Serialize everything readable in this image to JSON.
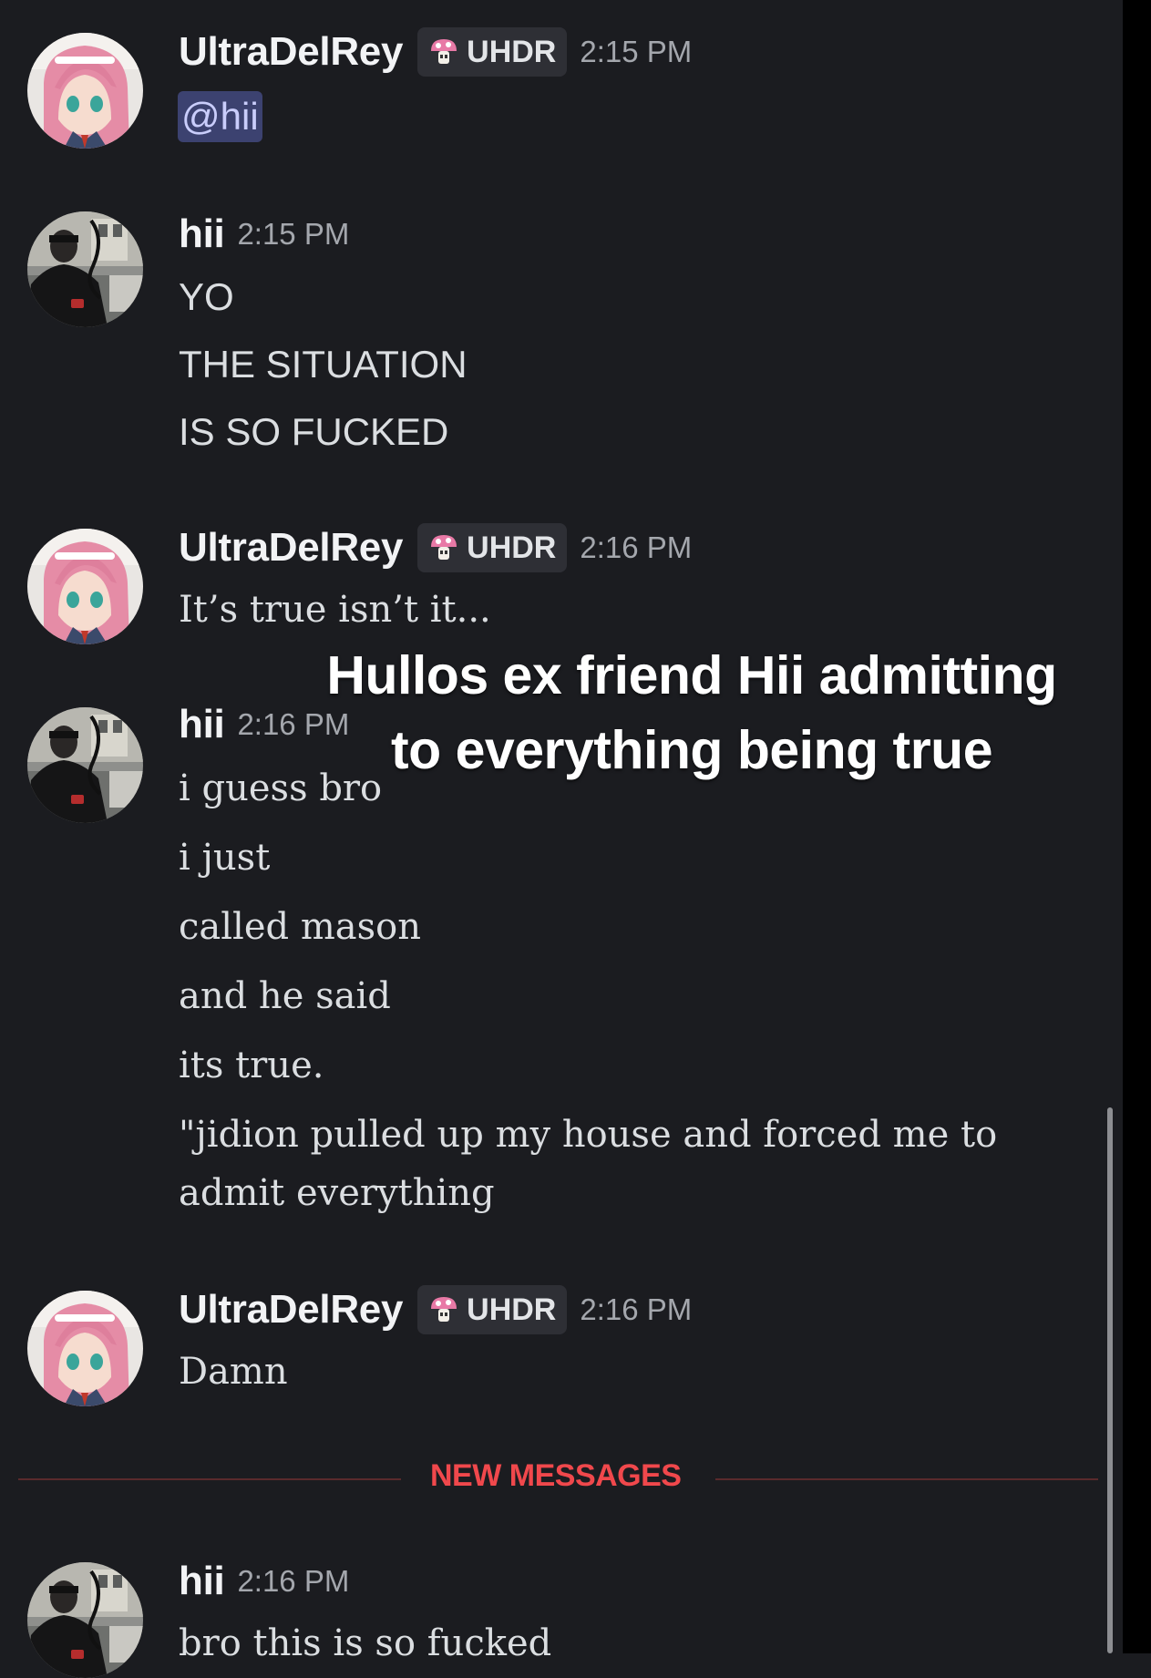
{
  "colors": {
    "background": "#1b1c20",
    "mention_bg": "#3c4270",
    "new_messages": "#f0484c",
    "tag_bg": "#2e2f35"
  },
  "messages": [
    {
      "username": "UltraDelRey",
      "tag": "UHDR",
      "tag_icon": "mushroom-icon",
      "time": "2:15 PM",
      "mention": "@hii",
      "lines": []
    },
    {
      "username": "hii",
      "time": "2:15 PM",
      "lines": [
        "YO",
        "THE SITUATION",
        "IS SO FUCKED"
      ]
    },
    {
      "username": "UltraDelRey",
      "tag": "UHDR",
      "tag_icon": "mushroom-icon",
      "time": "2:16 PM",
      "lines": [
        "It’s true isn’t it..."
      ]
    },
    {
      "username": "hii",
      "time": "2:16 PM",
      "lines": [
        "i guess bro",
        "i just",
        "called mason",
        "and he said",
        "its true.",
        "\"jidion pulled up my house and forced me to",
        "admit everything"
      ]
    },
    {
      "username": "UltraDelRey",
      "tag": "UHDR",
      "tag_icon": "mushroom-icon",
      "time": "2:16 PM",
      "lines": [
        "Damn"
      ]
    },
    {
      "username": "hii",
      "time": "2:16 PM",
      "lines": [
        "bro this is so fucked"
      ]
    }
  ],
  "divider_label": "NEW MESSAGES",
  "overlay_caption": {
    "line1": "Hullos ex friend Hii admitting",
    "line2": "to everything being true"
  }
}
